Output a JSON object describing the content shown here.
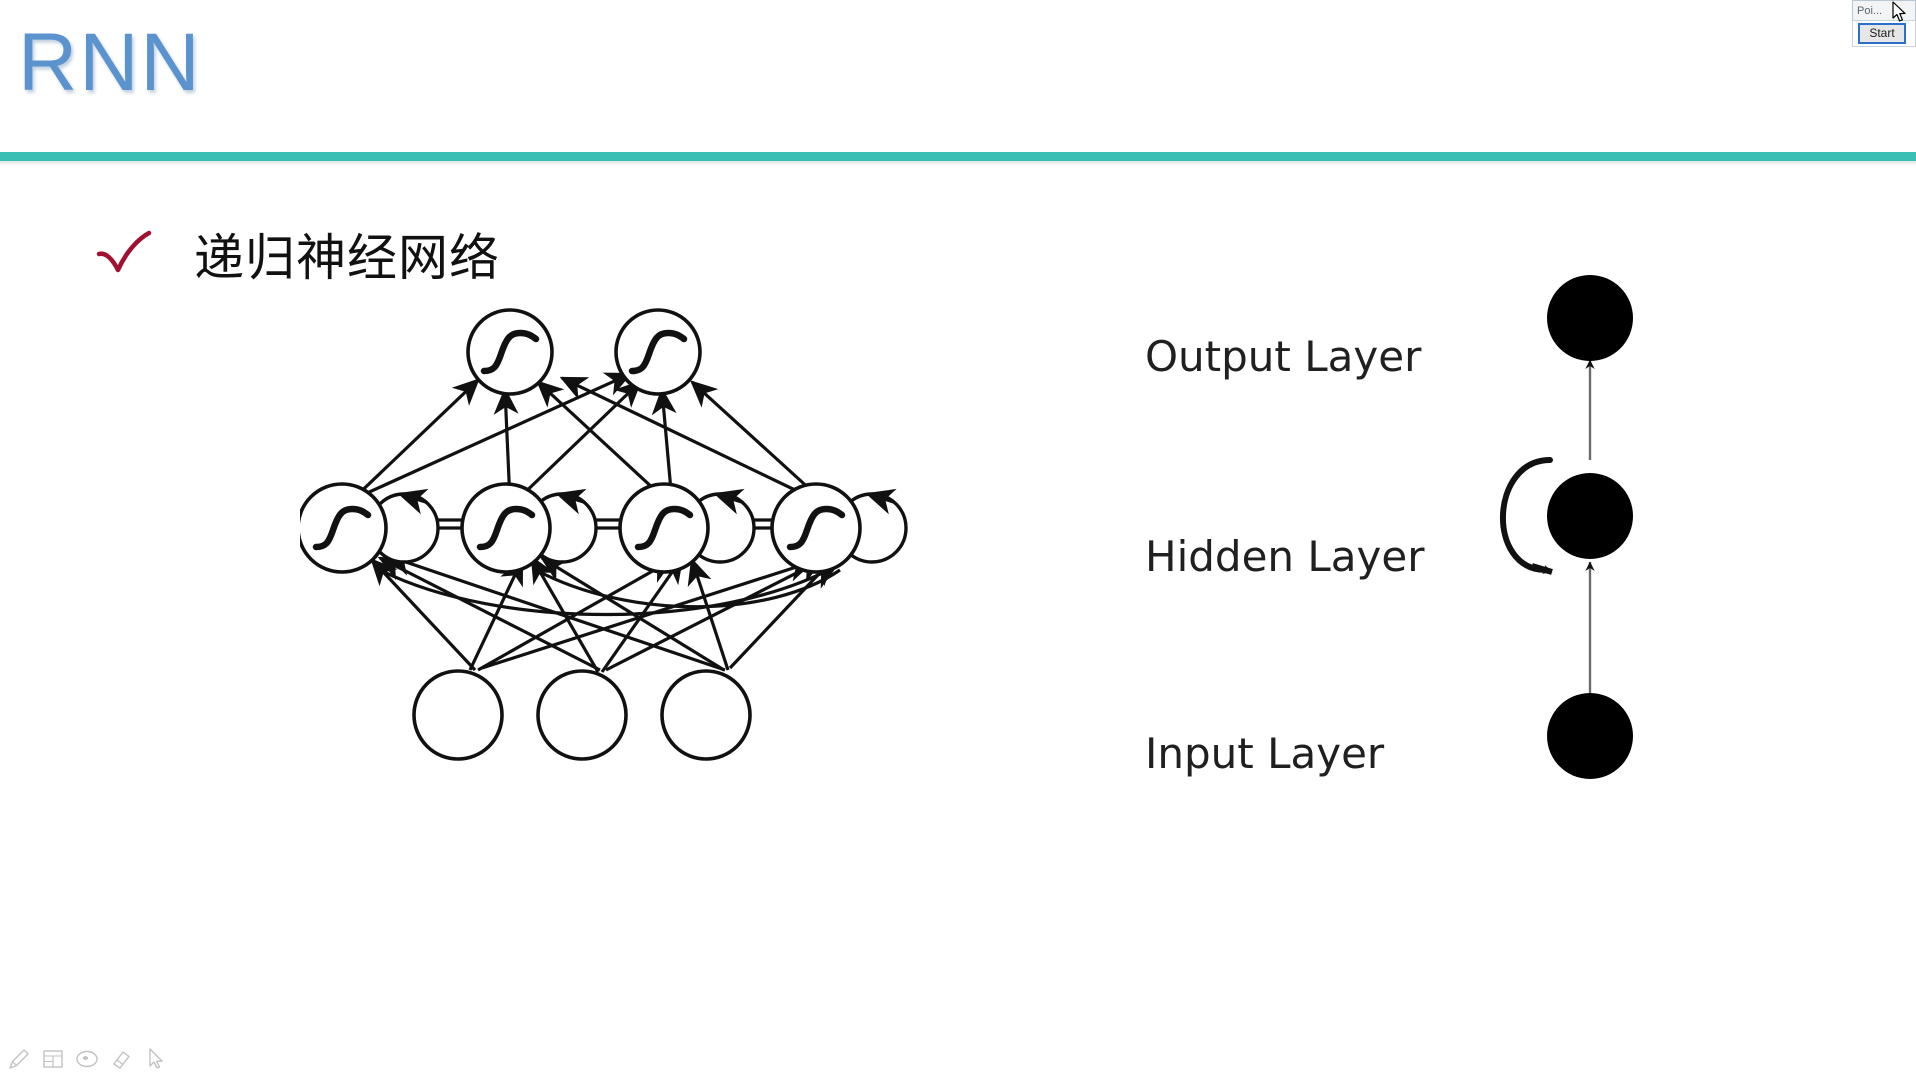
{
  "slide": {
    "title": "RNN",
    "title_color": "#5b93ce",
    "rule_color": "#3bbfb5",
    "background": "#ffffff"
  },
  "bullet": {
    "icon": "check-icon",
    "icon_color": "#a01030",
    "text": "递归神经网络"
  },
  "figure": {
    "left_diagram": {
      "name": "recurrent-neural-network-architecture",
      "output_neurons": 2,
      "hidden_neurons": 4,
      "input_neurons": 3,
      "neuron_glyph": "sigmoid-curve",
      "self_loops": true,
      "stroke_color": "#111111"
    },
    "layer_labels": {
      "output": "Output Layer",
      "hidden": "Hidden Layer",
      "input": "Input Layer"
    },
    "right_diagram": {
      "name": "folded-rnn-schematic",
      "nodes": 3,
      "node_fill": "#000000",
      "self_loop": true
    }
  },
  "float_widget": {
    "title": "Poi...",
    "start_label": "Start",
    "focus_color": "#2a6fc9"
  },
  "ink_toolbar": {
    "tools": [
      {
        "name": "pen-icon",
        "label": "Pen"
      },
      {
        "name": "slide-grid-icon",
        "label": "Slides"
      },
      {
        "name": "ellipse-icon",
        "label": "Ellipse"
      },
      {
        "name": "eraser-icon",
        "label": "Eraser"
      },
      {
        "name": "pointer-icon",
        "label": "Pointer"
      }
    ]
  }
}
